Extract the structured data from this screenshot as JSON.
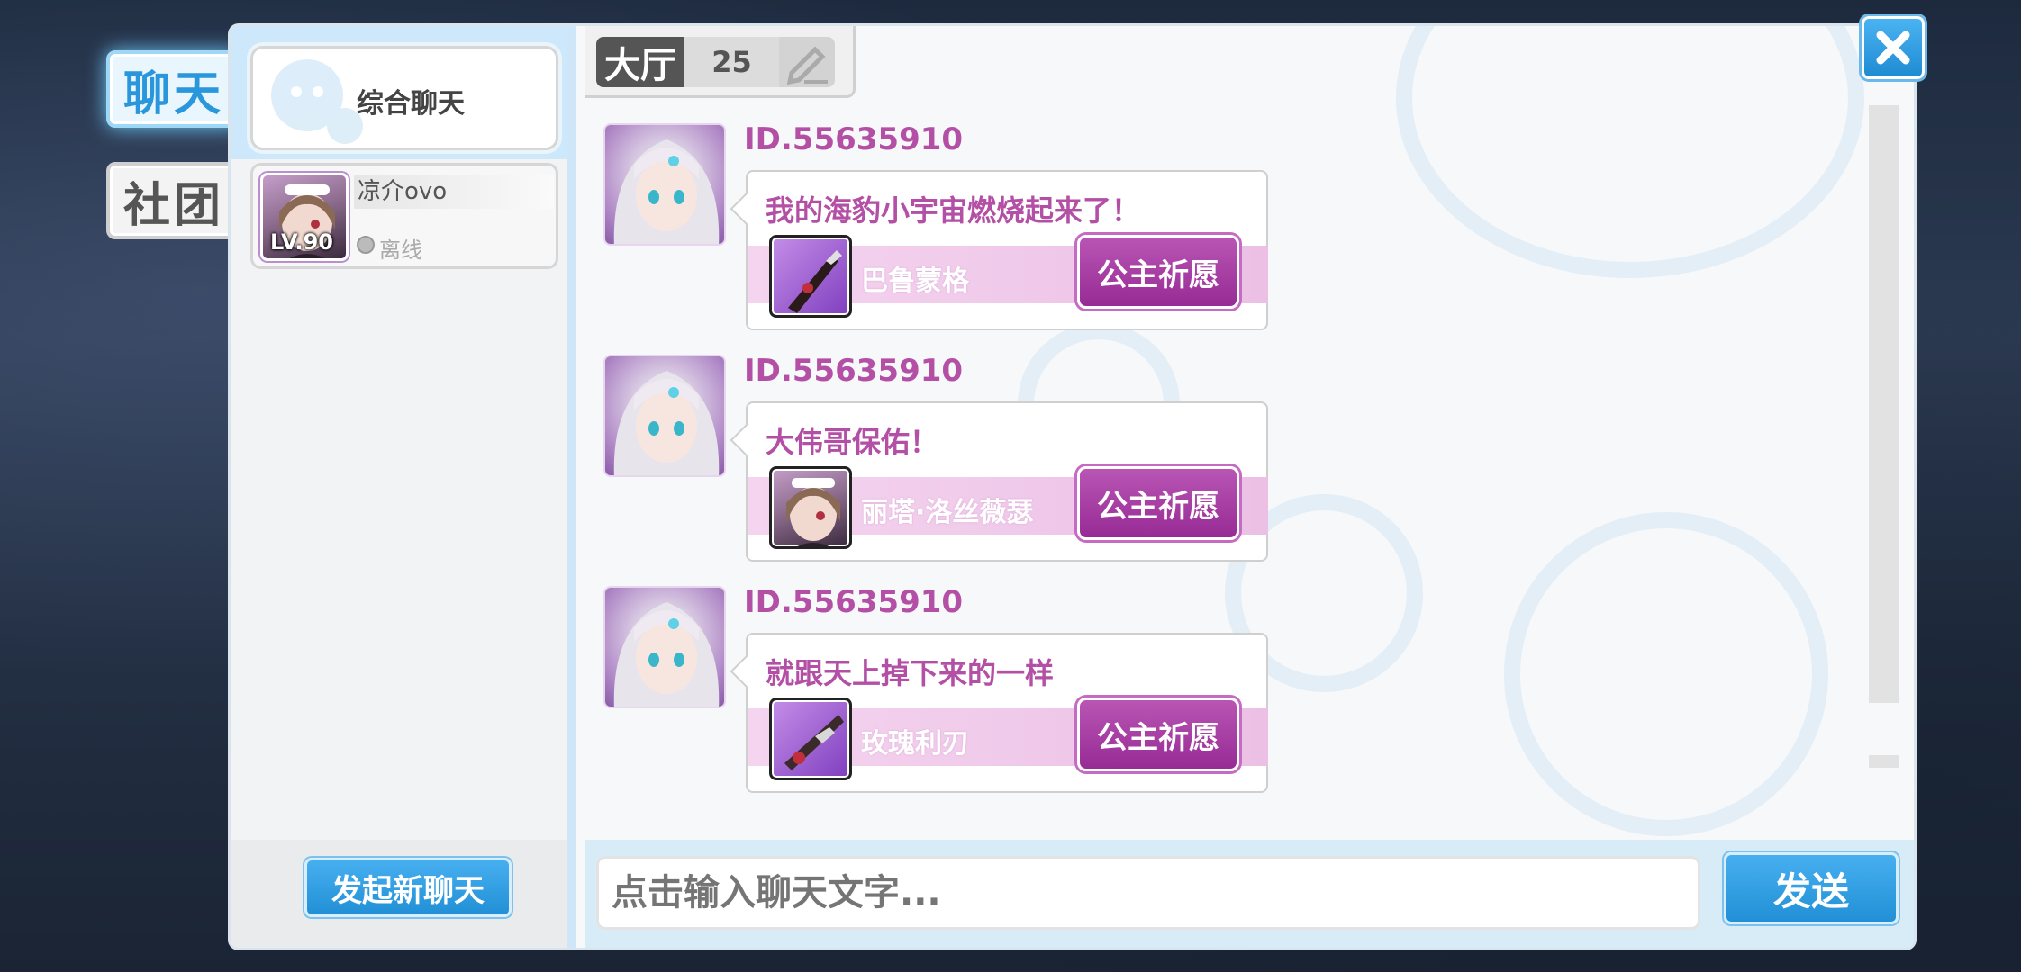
{
  "side_tabs": {
    "chat": "聊天",
    "club": "社团"
  },
  "conversation": {
    "title": "综合聊天"
  },
  "friend": {
    "name": "凉介ovo",
    "level": "LV.90",
    "status": "离线"
  },
  "new_chat_label": "发起新聊天",
  "room": {
    "label": "大厅",
    "count": "25"
  },
  "messages": [
    {
      "user_id": "ID.55635910",
      "text": "我的海豹小宇宙燃烧起来了！",
      "item_name": "巴鲁蒙格",
      "item_icon": "purple-weapon-icon",
      "wish_label": "公主祈愿"
    },
    {
      "user_id": "ID.55635910",
      "text": "大伟哥保佑！",
      "item_name": "丽塔·洛丝薇瑟",
      "item_icon": "character-portrait-icon",
      "wish_label": "公主祈愿"
    },
    {
      "user_id": "ID.55635910",
      "text": "就跟天上掉下来的一样",
      "item_name": "玫瑰利刃",
      "item_icon": "purple-weapon-icon",
      "wish_label": "公主祈愿"
    }
  ],
  "input": {
    "placeholder": "点击输入聊天文字..."
  },
  "send_label": "发送",
  "colors": {
    "accent_blue": "#2a97dc",
    "message_pink": "#b34fa5",
    "wish_purple": "#972b95"
  }
}
